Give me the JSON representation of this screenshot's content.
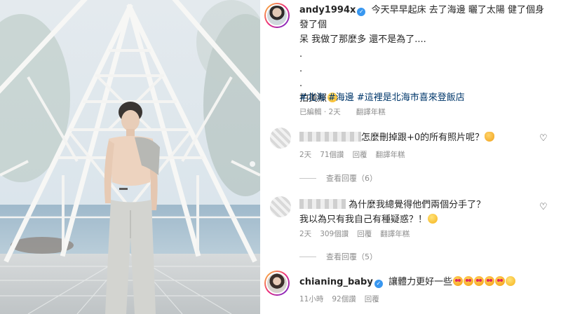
{
  "post": {
    "author": "andy1994x",
    "caption_lines": [
      "今天早早起床 去了海邊 曬了太陽 健了個身 發了個",
      "呆 我做了那麼多 還不是為了....",
      ".",
      ".",
      ".",
      "拍美照"
    ],
    "hashtags": [
      "#北海",
      "#海邊",
      "#這裡是北海市喜來登飯店"
    ],
    "edited": "已編輯",
    "age": "2天",
    "translate": "翻譯年糕"
  },
  "comments": [
    {
      "text": "怎麼刪掉跟+0的所有照片呢？",
      "age": "2天",
      "likes": "71個讚",
      "reply": "回覆",
      "translate": "翻譯年糕",
      "view_replies": "查看回覆（6）"
    },
    {
      "text_line1": "為什麼我總覺得他們兩個分手了？",
      "text_line2": "我以為只有我自己有種疑惑？！",
      "age": "2天",
      "likes": "309個讚",
      "reply": "回覆",
      "translate": "翻譯年糕",
      "view_replies": "查看回覆（5）"
    },
    {
      "user": "chianing_baby",
      "text": "讓體力更好一些",
      "age": "11小時",
      "likes": "92個讚",
      "reply": "回覆"
    }
  ],
  "icons": {
    "verified": "verified-badge-icon",
    "like": "heart-outline-icon"
  },
  "colors": {
    "hashtag": "#00376b",
    "meta_gray": "#8e8e8e",
    "verified_blue": "#3897f0"
  }
}
